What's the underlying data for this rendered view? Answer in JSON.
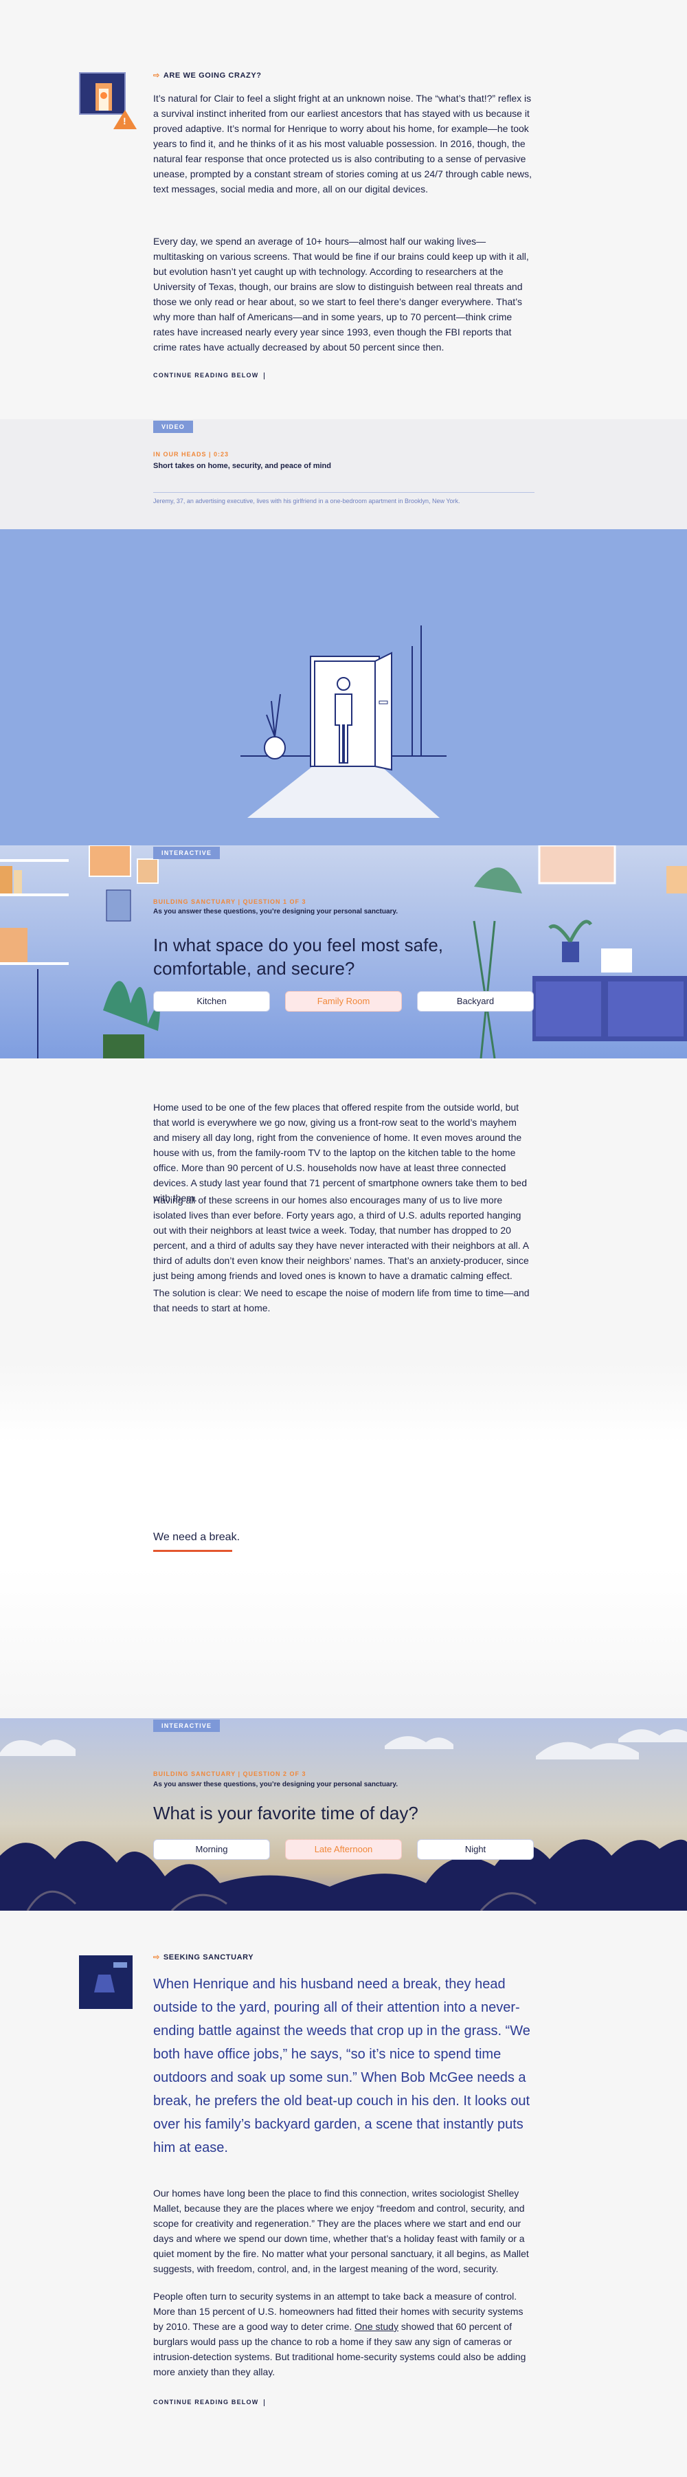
{
  "section1": {
    "kicker": "ARE WE GOING CRAZY?",
    "p1": "It’s natural for Clair to feel a slight fright at an unknown noise. The “what’s that!?” reflex is a survival instinct inherited from our earliest ancestors that has stayed with us because it proved adaptive. It’s normal for Henrique to worry about his home, for example—he took years to find it, and he thinks of it as his most valuable possession. In 2016, though, the natural fear response that once protected us is also contributing to a sense of pervasive unease, prompted by a constant stream of stories coming at us 24/7 through cable news, text messages, social media and more, all on our digital devices.",
    "p2": "Every day, we spend an average of 10+ hours—almost half our waking lives—multitasking on various screens. That would be fine if our brains could keep up with it all, but evolution hasn’t yet caught up with technology. According to researchers at the University of Texas, though, our brains are slow to distinguish between real threats and those we only read or hear about, so we start to feel there’s danger everywhere. That’s why more than half of Americans—and in some years, up to 70 percent—think crime rates have increased nearly every year since 1993, even though the FBI reports that crime rates have actually decreased by about 50 percent since then.",
    "continue": "CONTINUE READING BELOW"
  },
  "video": {
    "tag": "VIDEO",
    "series": "IN OUR HEADS | 0:23",
    "title": "Short takes on home, security, and peace of mind",
    "caption": "Jeremy, 37, an advertising executive, lives with his girlfriend in a one-bedroom apartment in Brooklyn, New York."
  },
  "interactive1": {
    "tag": "INTERACTIVE",
    "series": "BUILDING SANCTUARY | QUESTION 1 OF 3",
    "subtitle": "As you answer these questions, you’re designing your personal sanctuary.",
    "question": "In what space do you feel most safe, comfortable, and secure?",
    "options": [
      "Kitchen",
      "Family Room",
      "Backyard"
    ],
    "selected": "Family Room"
  },
  "section3": {
    "p1": "Home used to be one of the few places that offered respite from the outside world, but that world is everywhere we go now, giving us a front-row seat to the world’s mayhem and misery all day long, right from the convenience of home. It even moves around the house with us, from the family-room TV to the laptop on the kitchen table to the home office. More than 90 percent of U.S. households now have at least three connected devices. A study last year found that 71 percent of smartphone owners take them to bed with them.",
    "p2": "Having all of these screens in our homes also encourages many of us to live more isolated lives than ever before. Forty years ago, a third of U.S. adults reported hanging out with their neighbors at least twice a week. Today, that number has dropped to 20 percent, and a third of adults say they have never interacted with their neighbors at all. A third of adults don’t even know their neighbors’ names. That’s an anxiety-producer, since just being among friends and loved ones is known to have a dramatic calming effect.",
    "p3": "The solution is clear: We need to escape the noise of modern life from time to time—and that needs to start at home.",
    "break": "We need a break."
  },
  "interactive2": {
    "tag": "INTERACTIVE",
    "series": "BUILDING SANCTUARY | QUESTION 2 OF 3",
    "subtitle": "As you answer these questions, you’re designing your personal sanctuary.",
    "question": "What is your favorite time of day?",
    "options": [
      "Morning",
      "Late Afternoon",
      "Night"
    ],
    "selected": "Late Afternoon"
  },
  "section4": {
    "kicker": "SEEKING SANCTUARY",
    "lead": "When Henrique and his husband need a break, they head outside to the yard, pouring all of their attention into a never-ending battle against the weeds that crop up in the grass. “We both have office jobs,” he says, “so it’s nice to spend time outdoors and soak up some sun.” When Bob McGee needs a break, he prefers the old beat-up couch in his den. It looks out over his family’s backyard garden, a scene that instantly puts him at ease.",
    "p1": "Our homes have long been the place to find this connection, writes sociologist Shelley Mallet, because they are the places where we enjoy “freedom and control, security, and scope for creativity and regeneration.” They are the places where we start and end our days and where we spend our down time, whether that’s a holiday feast with family or a quiet moment by the fire. No matter what your personal sanctuary, it all begins, as Mallet suggests, with freedom, control, and, in the largest meaning of the word, security.",
    "p2_before": "People often turn to security systems in an attempt to take back a measure of control. More than 15 percent of U.S. homeowners had fitted their homes with security systems by 2010. These are a good way to deter crime. ",
    "p2_link": "One study",
    "p2_after": " showed that 60 percent of burglars would pass up the chance to rob a home if they saw any sign of cameras or intrusion-detection systems. But traditional home-security systems could also be adding more anxiety than they allay.",
    "continue": "CONTINUE READING BELOW"
  },
  "colors": {
    "accent": "#f0883a",
    "navy": "#1c2145",
    "video_bg": "#8eaae2",
    "link_blue": "#2c3b93"
  }
}
